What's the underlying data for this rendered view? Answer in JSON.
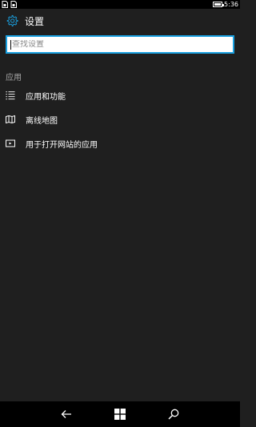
{
  "status_bar": {
    "time": "5:36",
    "left_icons": [
      "sim-icon",
      "sim-icon-2"
    ],
    "right_icons": [
      "battery-icon"
    ],
    "battery_level": 0.9
  },
  "header": {
    "title": "设置",
    "icon": "gear-icon"
  },
  "search": {
    "placeholder": "查找设置",
    "value": ""
  },
  "section": {
    "title": "应用",
    "items": [
      {
        "label": "应用和功能",
        "icon": "list-icon"
      },
      {
        "label": "离线地图",
        "icon": "map-icon"
      },
      {
        "label": "用于打开网站的应用",
        "icon": "web-app-icon"
      }
    ]
  },
  "nav_bar": {
    "buttons": [
      "back-arrow-icon",
      "windows-start-icon",
      "search-icon"
    ]
  },
  "colors": {
    "accent": "#1aa1e1",
    "background": "#1f1f1f",
    "bar": "#000000"
  }
}
